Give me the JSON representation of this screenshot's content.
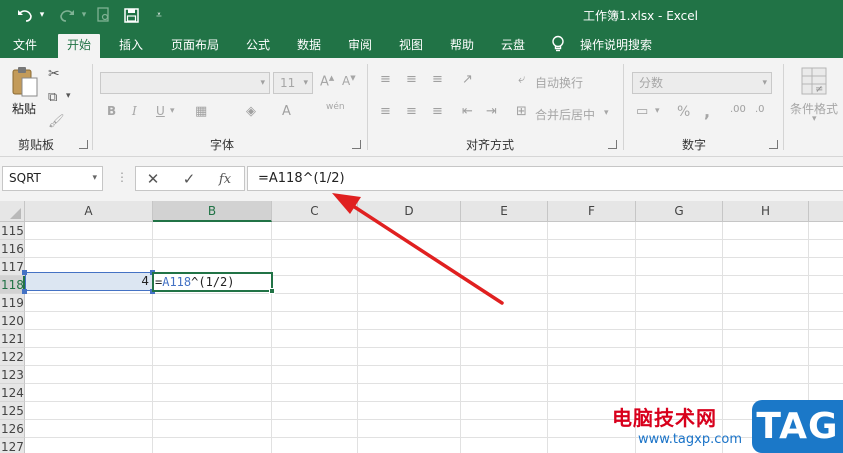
{
  "window": {
    "title": "工作簿1.xlsx  -  Excel"
  },
  "qat": {
    "undo_icon": "undo-icon",
    "redo_icon": "redo-icon",
    "print_preview_icon": "print-preview-icon",
    "save_icon": "save-icon",
    "customize_icon": "customize-qat-icon"
  },
  "tabs": [
    {
      "label": "文件"
    },
    {
      "label": "开始"
    },
    {
      "label": "插入"
    },
    {
      "label": "页面布局"
    },
    {
      "label": "公式"
    },
    {
      "label": "数据"
    },
    {
      "label": "审阅"
    },
    {
      "label": "视图"
    },
    {
      "label": "帮助"
    },
    {
      "label": "云盘"
    },
    {
      "label": "操作说明搜索"
    }
  ],
  "ribbon": {
    "clipboard": {
      "paste_label": "粘贴",
      "group_label": "剪贴板"
    },
    "font": {
      "font_size": "11",
      "bold": "B",
      "italic": "I",
      "underline": "U",
      "phonetic": "wén",
      "group_label": "字体"
    },
    "alignment": {
      "wrap_text": "自动换行",
      "merge_center": "合并后居中",
      "group_label": "对齐方式"
    },
    "number": {
      "format": "分数",
      "percent": "%",
      "comma": ",",
      "group_label": "数字"
    },
    "styles": {
      "conditional_format": "条件格式"
    }
  },
  "formula_bar": {
    "name_box": "SQRT",
    "cancel": "✕",
    "enter": "✓",
    "fx": "fx",
    "formula": "=A118^(1/2)"
  },
  "grid": {
    "columns": [
      "A",
      "B",
      "C",
      "D",
      "E",
      "F",
      "G",
      "H"
    ],
    "rows": [
      "115",
      "116",
      "117",
      "118",
      "119",
      "120",
      "121",
      "122",
      "123",
      "124",
      "125",
      "126",
      "127"
    ],
    "cell_a118": "4",
    "cell_b118_prefix": "=",
    "cell_b118_ref": "A118",
    "cell_b118_rest": "^(1/2)"
  },
  "colors": {
    "excel_green": "#217346",
    "reference_blue": "#4472c4",
    "annotation_red": "#e02020"
  },
  "watermark": {
    "title": "电脑技术网",
    "url": "www.tagxp.com",
    "badge": "TAG"
  }
}
